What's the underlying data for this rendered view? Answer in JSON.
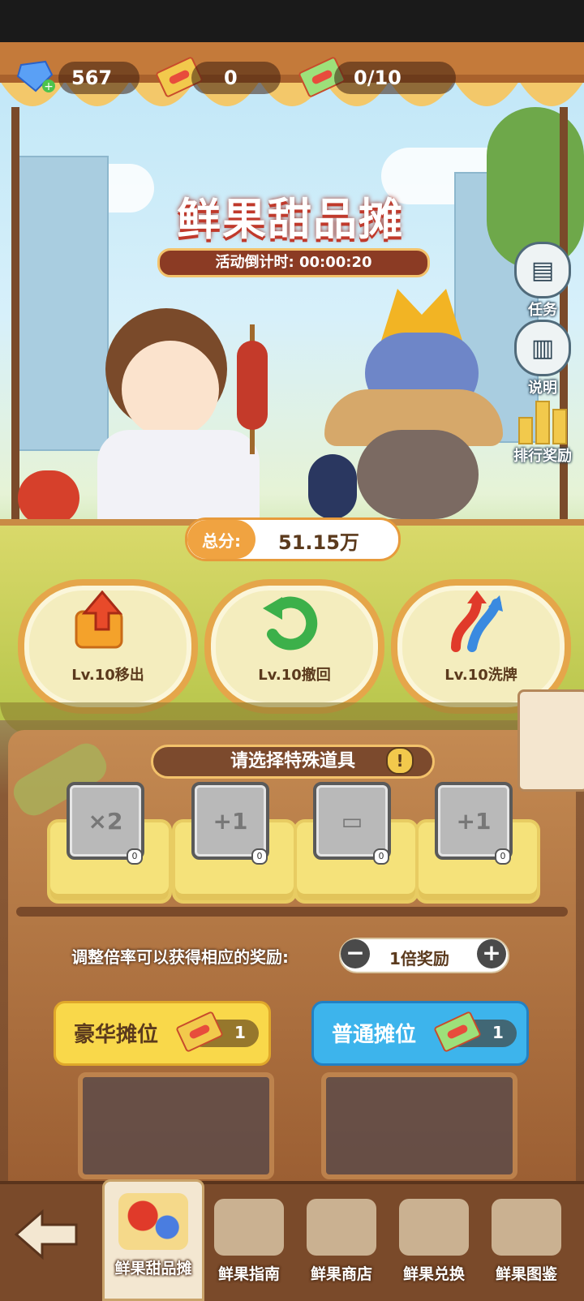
{
  "topbar": {
    "gems": "567",
    "tickets": "0",
    "daily_tickets": "0/10"
  },
  "title": "鲜果甜品摊",
  "timer": "活动倒计时: 00:00:20",
  "side_buttons": [
    {
      "label": "任务",
      "icon": "clipboard-icon"
    },
    {
      "label": "说明",
      "icon": "book-icon"
    },
    {
      "label": "排行奖励",
      "icon": "trophy-bars-icon"
    }
  ],
  "score": {
    "label": "总分:",
    "value": "51.15万"
  },
  "powerups": [
    {
      "label": "Lv.10移出",
      "icon": "move-out-arrow-icon"
    },
    {
      "label": "Lv.10撤回",
      "icon": "undo-arrow-icon"
    },
    {
      "label": "Lv.10洗牌",
      "icon": "shuffle-arrows-icon"
    }
  ],
  "special_prompt": "请选择特殊道具",
  "special_items": [
    {
      "glyph": "×2",
      "count": "0",
      "icon": "double-ticket-icon"
    },
    {
      "glyph": "+1",
      "count": "0",
      "icon": "plus-one-tiles-icon"
    },
    {
      "glyph": "▭",
      "count": "0",
      "icon": "lunchbox-icon"
    },
    {
      "glyph": "+1",
      "count": "0",
      "icon": "plus-one-box-icon"
    }
  ],
  "multiplier": {
    "label": "调整倍率可以获得相应的奖励:",
    "value": "1倍奖励",
    "minus": "−",
    "plus": "+"
  },
  "stalls": [
    {
      "label": "豪华摊位",
      "cost": "1",
      "color": "#f9d84a"
    },
    {
      "label": "普通摊位",
      "cost": "1",
      "color": "#3db4ec"
    }
  ],
  "nav": [
    {
      "label": "鲜果甜品摊",
      "active": true
    },
    {
      "label": "鲜果指南"
    },
    {
      "label": "鲜果商店"
    },
    {
      "label": "鲜果兑换"
    },
    {
      "label": "鲜果图鉴"
    }
  ],
  "colors": {
    "accent": "#e79a3b",
    "wood": "#7a4a2a",
    "title_red": "#c0392b"
  }
}
